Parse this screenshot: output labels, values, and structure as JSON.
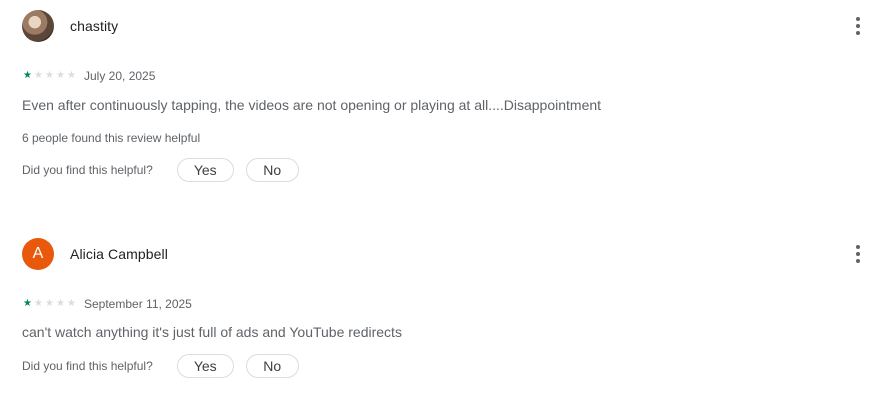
{
  "reviews": [
    {
      "author": "chastity",
      "avatar_type": "photo",
      "rating": 1,
      "max_rating": 5,
      "date": "July 20, 2025",
      "text": "Even after continuously tapping, the videos are not opening or playing at all....Disappointment",
      "helpful_count_text": "6 people found this review helpful",
      "helpful_prompt": "Did you find this helpful?",
      "yes_label": "Yes",
      "no_label": "No"
    },
    {
      "author": "Alicia Campbell",
      "avatar_type": "letter",
      "avatar_letter": "A",
      "avatar_color": "#e8590c",
      "rating": 1,
      "max_rating": 5,
      "date": "September 11, 2025",
      "text": "can't watch anything it's just full of ads and YouTube redirects",
      "helpful_prompt": "Did you find this helpful?",
      "yes_label": "Yes",
      "no_label": "No"
    }
  ],
  "icons": {
    "star": "star-icon",
    "menu": "more-vert-icon"
  },
  "colors": {
    "star_filled": "#01875f",
    "star_empty": "#dadce0"
  }
}
